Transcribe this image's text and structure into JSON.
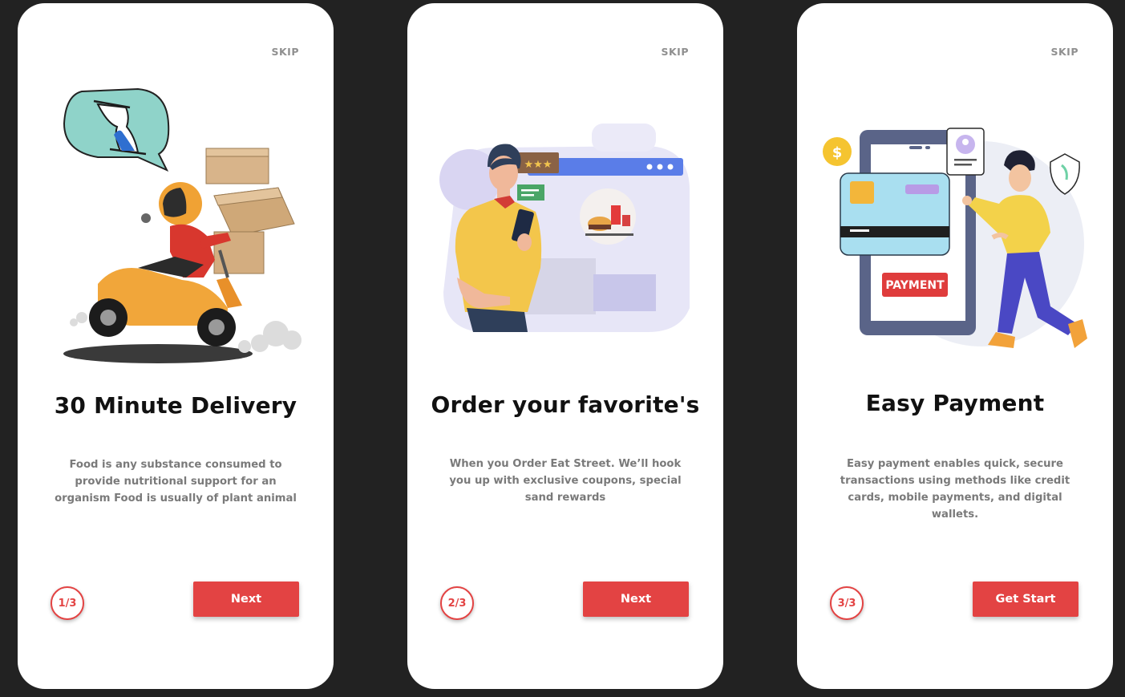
{
  "screens": [
    {
      "skip_label": "SKIP",
      "title": "30 Minute Delivery",
      "description": "Food is any substance consumed to provide nutritional support for an organism Food is usually of plant animal",
      "step": "1/3",
      "button_label": "Next"
    },
    {
      "skip_label": "SKIP",
      "title": "Order your favorite's",
      "description": "When you Order Eat Street. We’ll hook you up with exclusive coupons, special sand rewards",
      "step": "2/3",
      "button_label": "Next"
    },
    {
      "skip_label": "SKIP",
      "title": "Easy Payment",
      "description": "Easy payment enables quick, secure transactions using methods like credit cards, mobile payments, and digital wallets.",
      "step": "3/3",
      "button_label": "Get Start",
      "card_label": "PAYMENT"
    }
  ],
  "colors": {
    "background": "#222222",
    "accent": "#e34343",
    "card": "#ffffff"
  }
}
